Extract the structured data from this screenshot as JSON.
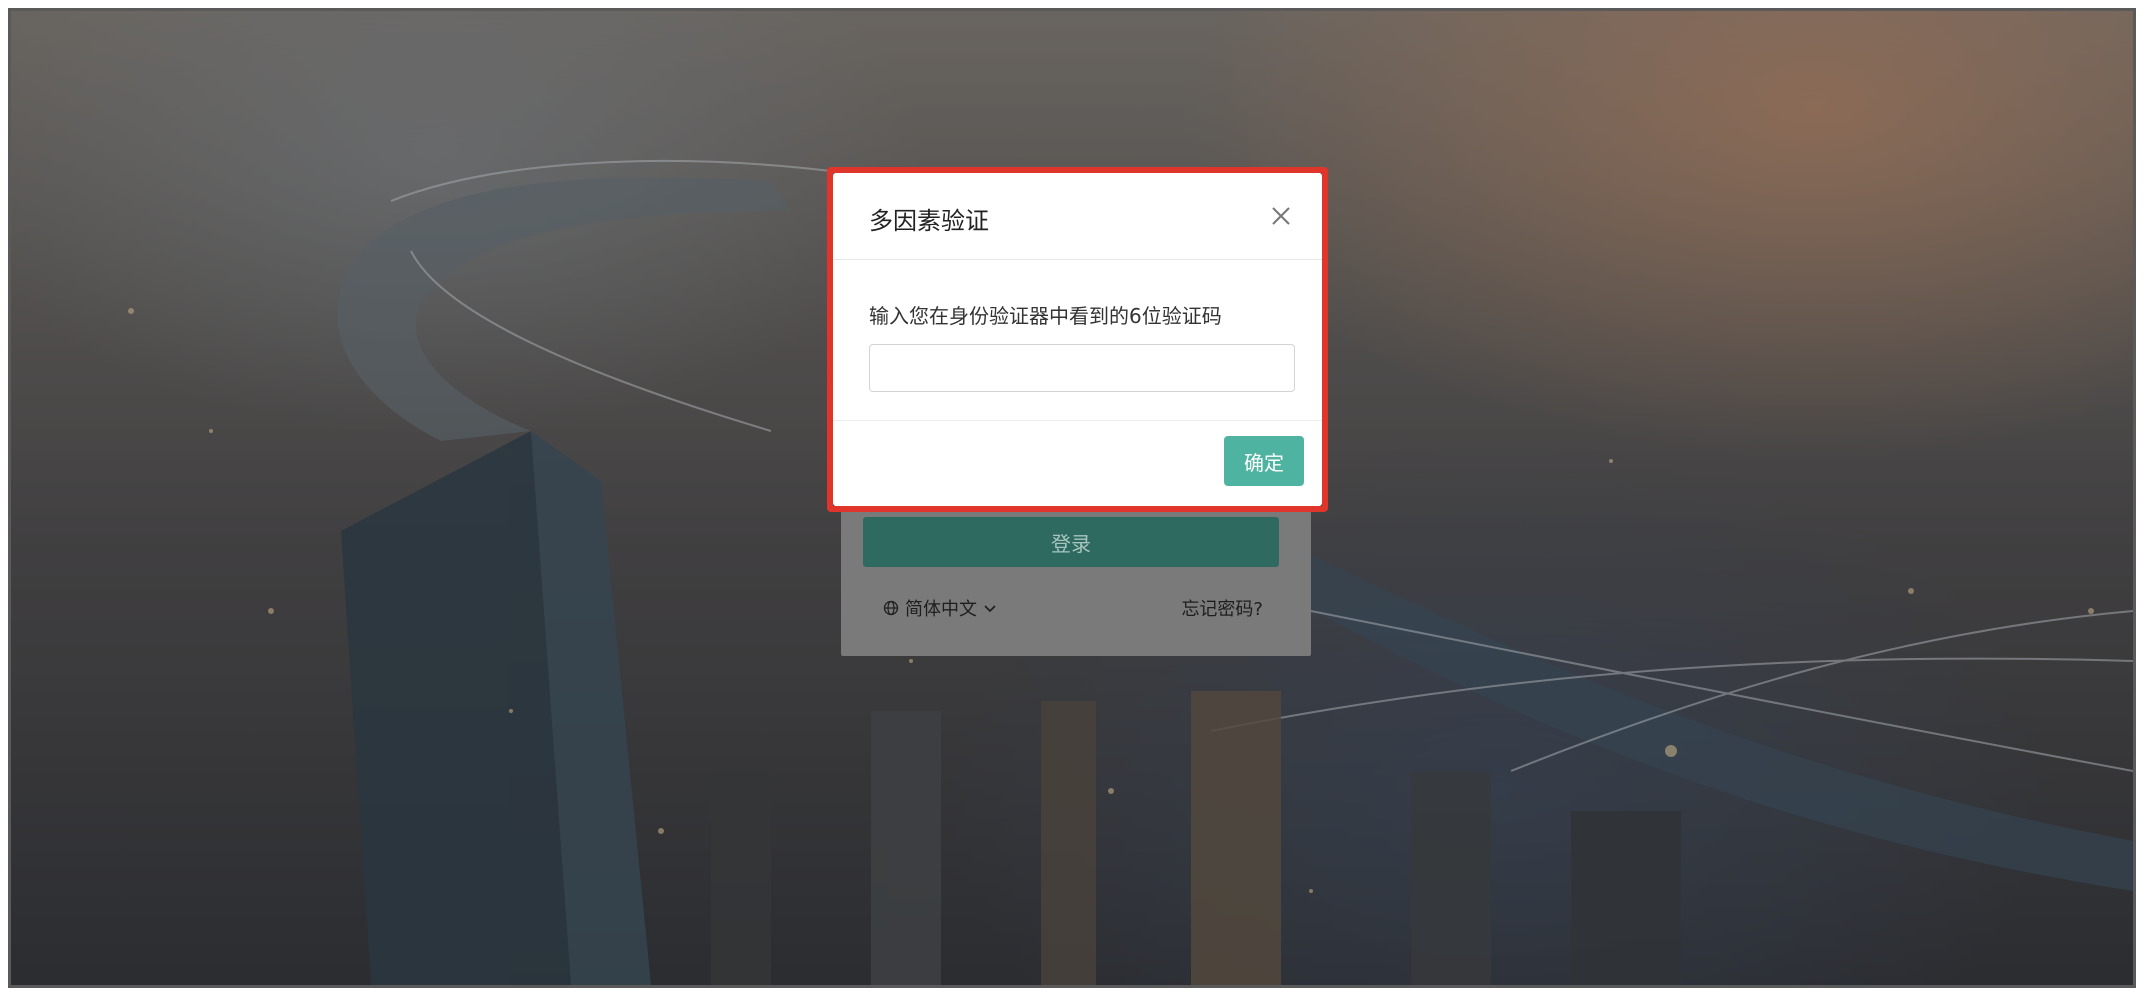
{
  "modal": {
    "title": "多因素验证",
    "prompt": "输入您在身份验证器中看到的6位验证码",
    "code_value": "",
    "code_placeholder": "",
    "confirm_label": "确定"
  },
  "login": {
    "login_label": "登录",
    "language_label": "简体中文",
    "forgot_label": "忘记密码?"
  },
  "colors": {
    "highlight": "#e0352b",
    "confirm": "#4fb3a1",
    "login_button": "#2e6a60"
  },
  "icons": {
    "close": "close-icon",
    "globe": "globe-icon",
    "chevron": "chevron-down-icon"
  }
}
